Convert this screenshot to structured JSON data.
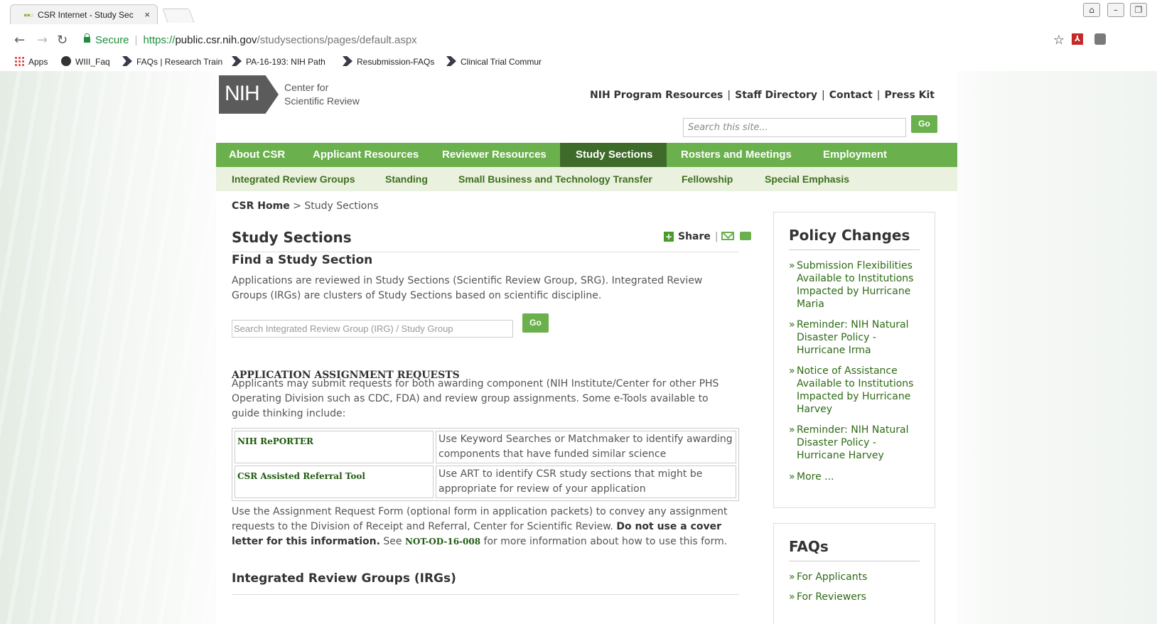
{
  "browser": {
    "tab_title": "CSR Internet - Study Sec",
    "secure_label": "Secure",
    "url_scheme": "https://",
    "url_host": "public.csr.nih.gov",
    "url_path": "/studysections/pages/default.aspx",
    "bookmarks": [
      "Apps",
      "WIII_Faq",
      "FAQs | Research Train",
      "PA-16-193: NIH Path",
      "Resubmission-FAQs",
      "Clinical Trial Commur"
    ]
  },
  "header": {
    "logo_mark": "NIH",
    "logo_line1": "Center for",
    "logo_line2": "Scientific Review",
    "top_links": [
      "NIH Program Resources",
      "Staff Directory",
      "Contact",
      "Press Kit"
    ],
    "search_placeholder": "Search this site...",
    "search_go": "Go"
  },
  "main_nav": [
    "About CSR",
    "Applicant Resources",
    "Reviewer Resources",
    "Study Sections",
    "Rosters and Meetings",
    "Employment"
  ],
  "sub_nav": [
    "Integrated Review Groups",
    "Standing",
    "Small Business and Technology Transfer",
    "Fellowship",
    "Special Emphasis"
  ],
  "breadcrumb": {
    "home": "CSR Home",
    "separator": " > ",
    "current": "Study Sections"
  },
  "main": {
    "title": "Study Sections",
    "share_label": "Share",
    "find_heading": "Find a Study Section",
    "find_text": "Applications are reviewed in Study Sections (Scientific Review Group, SRG). Integrated Review Groups (IRGs) are clusters of Study Sections based on scientific discipline.",
    "irg_search_placeholder": "Search Integrated Review Group (IRG) / Study Group",
    "irg_go": "Go",
    "assign_heading": "APPLICATION ASSIGNMENT REQUESTS",
    "assign_text": "Applicants may submit requests for both awarding component (NIH Institute/Center for other PHS Operating Division such as CDC, FDA) and review group assignments. Some e-Tools available to guide thinking include:",
    "tools": [
      {
        "name": "NIH RePORTER",
        "desc": "Use Keyword Searches or Matchmaker to identify awarding components that have funded similar science"
      },
      {
        "name": "CSR Assisted Referral Tool",
        "desc": "Use ART to identify CSR study sections that might be appropriate for review of your application"
      }
    ],
    "form_text_1": "Use the Assignment Request Form (optional form in application packets) to convey any assignment requests to the Division of Receipt and Referral, Center for Scientific Review.",
    "form_bold": "Do not use a cover letter for this information.",
    "form_text_2": "See",
    "form_link": "NOT-OD-16-008",
    "form_text_3": "for more information about how to use this form.",
    "irg_heading": "Integrated Review Groups (IRGs)"
  },
  "sidebar": {
    "policy_title": "Policy Changes",
    "policy_items": [
      "Submission Flexibilities Available to Institutions Impacted by Hurricane Maria",
      "Reminder: NIH Natural Disaster Policy - Hurricane Irma",
      "Notice of Assistance Available to Institutions Impacted by Hurricane Harvey",
      "Reminder: NIH Natural Disaster Policy - Hurricane Harvey",
      "More ..."
    ],
    "faq_title": "FAQs",
    "faq_items": [
      "For Applicants",
      "For Reviewers"
    ]
  },
  "colors": {
    "brand_green": "#6ab04c",
    "active_green": "#3e6b2a",
    "subnav_bg": "#eaf1de",
    "link_green": "#2e6b15"
  }
}
